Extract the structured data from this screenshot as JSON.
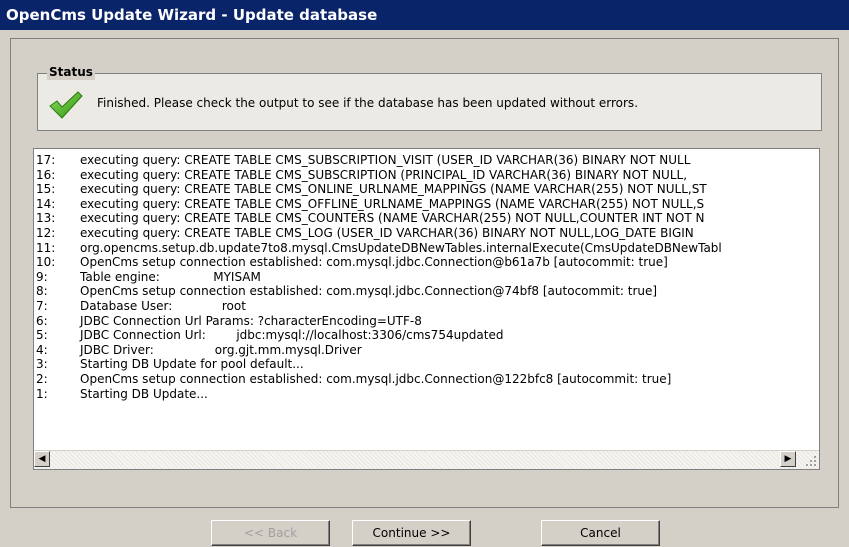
{
  "window": {
    "title": "OpenCms Update Wizard - Update database"
  },
  "status": {
    "legend": "Status",
    "icon": "checkmark-icon",
    "message": "Finished. Please check the output to see if the database has been updated without errors."
  },
  "log": {
    "lines": [
      {
        "num": "17:",
        "text": "executing query: CREATE TABLE CMS_SUBSCRIPTION_VISIT (USER_ID VARCHAR(36) BINARY NOT NULL"
      },
      {
        "num": "16:",
        "text": "executing query: CREATE TABLE CMS_SUBSCRIPTION (PRINCIPAL_ID VARCHAR(36) BINARY NOT NULL,"
      },
      {
        "num": "15:",
        "text": "executing query: CREATE TABLE CMS_ONLINE_URLNAME_MAPPINGS (NAME VARCHAR(255) NOT NULL,ST"
      },
      {
        "num": "14:",
        "text": "executing query: CREATE TABLE CMS_OFFLINE_URLNAME_MAPPINGS (NAME VARCHAR(255) NOT NULL,S"
      },
      {
        "num": "13:",
        "text": "executing query: CREATE TABLE CMS_COUNTERS (NAME VARCHAR(255) NOT NULL,COUNTER INT NOT N"
      },
      {
        "num": "12:",
        "text": "executing query: CREATE TABLE CMS_LOG (USER_ID VARCHAR(36) BINARY NOT NULL,LOG_DATE BIGIN"
      },
      {
        "num": "11:",
        "text": "org.opencms.setup.db.update7to8.mysql.CmsUpdateDBNewTables.internalExecute(CmsUpdateDBNewTabl"
      },
      {
        "num": "10:",
        "text": "OpenCms setup connection established: com.mysql.jdbc.Connection@b61a7b [autocommit: true]"
      },
      {
        "num": "9:",
        "text": "Table engine:              MYISAM"
      },
      {
        "num": "8:",
        "text": "OpenCms setup connection established: com.mysql.jdbc.Connection@74bf8 [autocommit: true]"
      },
      {
        "num": "7:",
        "text": "Database User:             root"
      },
      {
        "num": "6:",
        "text": "JDBC Connection Url Params: ?characterEncoding=UTF-8"
      },
      {
        "num": "5:",
        "text": "JDBC Connection Url:        jdbc:mysql://localhost:3306/cms754updated"
      },
      {
        "num": "4:",
        "text": "JDBC Driver:                org.gjt.mm.mysql.Driver"
      },
      {
        "num": "3:",
        "text": "Starting DB Update for pool default..."
      },
      {
        "num": "2:",
        "text": "OpenCms setup connection established: com.mysql.jdbc.Connection@122bfc8 [autocommit: true]"
      },
      {
        "num": "1:",
        "text": "Starting DB Update..."
      }
    ]
  },
  "buttons": {
    "back": "<< Back",
    "continue": "Continue >>",
    "cancel": "Cancel"
  }
}
